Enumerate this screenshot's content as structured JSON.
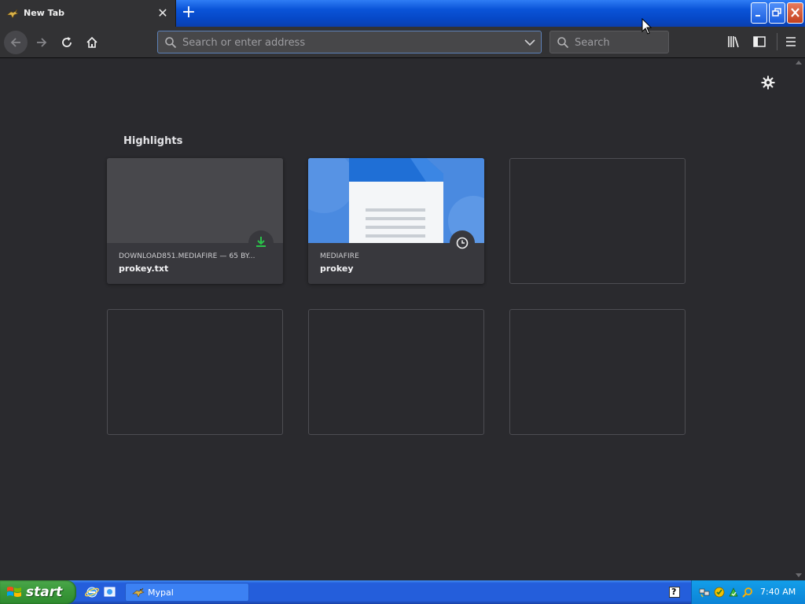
{
  "window": {
    "tab_title": "New Tab",
    "colors": {
      "titlebar": "#0a54d8",
      "toolbar": "#323234",
      "content_bg": "#2a2a2e"
    }
  },
  "toolbar": {
    "urlbar_placeholder": "Search or enter address",
    "searchbar_placeholder": "Search"
  },
  "content": {
    "section_title": "Highlights",
    "highlights": [
      {
        "source": "DOWNLOAD851.MEDIAFIRE — 65 BY...",
        "title": "prokey.txt",
        "badge_icon": "download-icon"
      },
      {
        "source": "MEDIAFIRE",
        "title": "prokey",
        "badge_icon": "clock-icon"
      }
    ]
  },
  "taskbar": {
    "start_label": "start",
    "task_label": "Mypal",
    "help_label": "?",
    "clock": "7:40 AM"
  }
}
